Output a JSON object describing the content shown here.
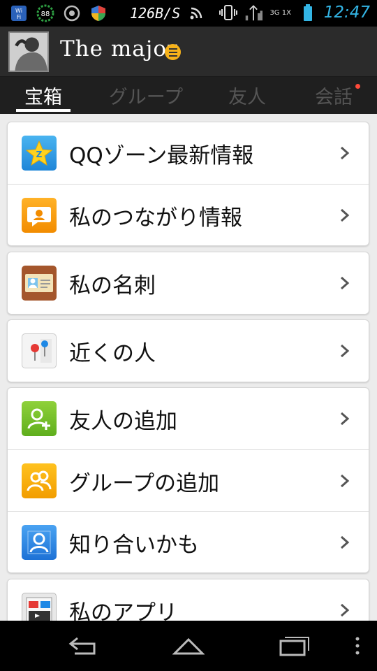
{
  "status_bar": {
    "speed": "126B/S",
    "time": "12:47",
    "network": "3G 1X",
    "icons": [
      "wifi-icon",
      "battery-circle-icon",
      "sync-icon",
      "shield-icon",
      "rss-icon",
      "vibrate-icon",
      "signal-icon",
      "battery-icon"
    ]
  },
  "profile": {
    "name": "The major",
    "status_icon": "online-status-icon"
  },
  "tabs": [
    {
      "label": "宝箱",
      "active": true
    },
    {
      "label": "グループ",
      "active": false
    },
    {
      "label": "友人",
      "active": false
    },
    {
      "label": "会話",
      "active": false,
      "has_dot": true
    }
  ],
  "menu": {
    "qzone": {
      "label": "QQゾーン最新情報",
      "icon": "qzone-star-icon"
    },
    "connections": {
      "label": "私のつながり情報",
      "icon": "chat-bubble-icon"
    },
    "business_card": {
      "label": "私の名刺",
      "icon": "business-card-icon"
    },
    "nearby": {
      "label": "近くの人",
      "icon": "map-pin-icon"
    },
    "add_friend": {
      "label": "友人の追加",
      "icon": "add-friend-icon"
    },
    "add_group": {
      "label": "グループの追加",
      "icon": "add-group-icon"
    },
    "may_know": {
      "label": "知り合いかも",
      "icon": "person-icon"
    },
    "my_apps": {
      "label": "私のアプリ",
      "icon": "apps-icon"
    }
  },
  "colors": {
    "accent": "#33b5e5",
    "header_bg": "#2b2b2b",
    "tab_bg": "#1f1f1f",
    "status_badge": "#f6b21a"
  }
}
